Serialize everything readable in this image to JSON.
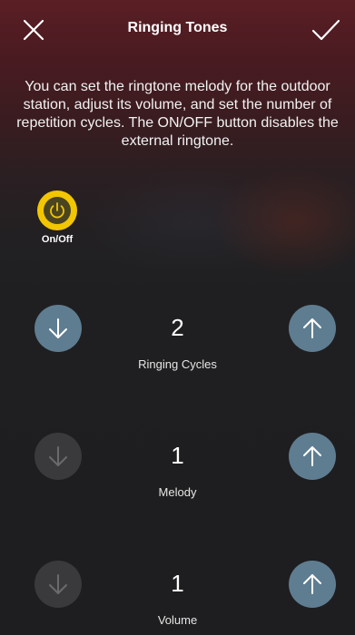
{
  "header": {
    "title": "Ringing Tones"
  },
  "description": "You can set the ringtone melody for the outdoor station, adjust its volume, and set the number of repetition cycles. The ON/OFF button disables the external ringtone.",
  "power": {
    "label": "On/Off",
    "state": "on",
    "color": "#f2c600"
  },
  "controls": [
    {
      "label": "Ringing Cycles",
      "value": "2",
      "decrease_enabled": true,
      "increase_enabled": true
    },
    {
      "label": "Melody",
      "value": "1",
      "decrease_enabled": false,
      "increase_enabled": true
    },
    {
      "label": "Volume",
      "value": "1",
      "decrease_enabled": false,
      "increase_enabled": true
    }
  ],
  "colors": {
    "accent_button": "#5f7d91",
    "disabled_button": "#3a3a3c",
    "header_tint": "#5a1e25"
  },
  "icons": {
    "close": "close-icon",
    "confirm": "checkmark-icon",
    "power": "power-icon",
    "decrease": "arrow-down-icon",
    "increase": "arrow-up-icon"
  }
}
